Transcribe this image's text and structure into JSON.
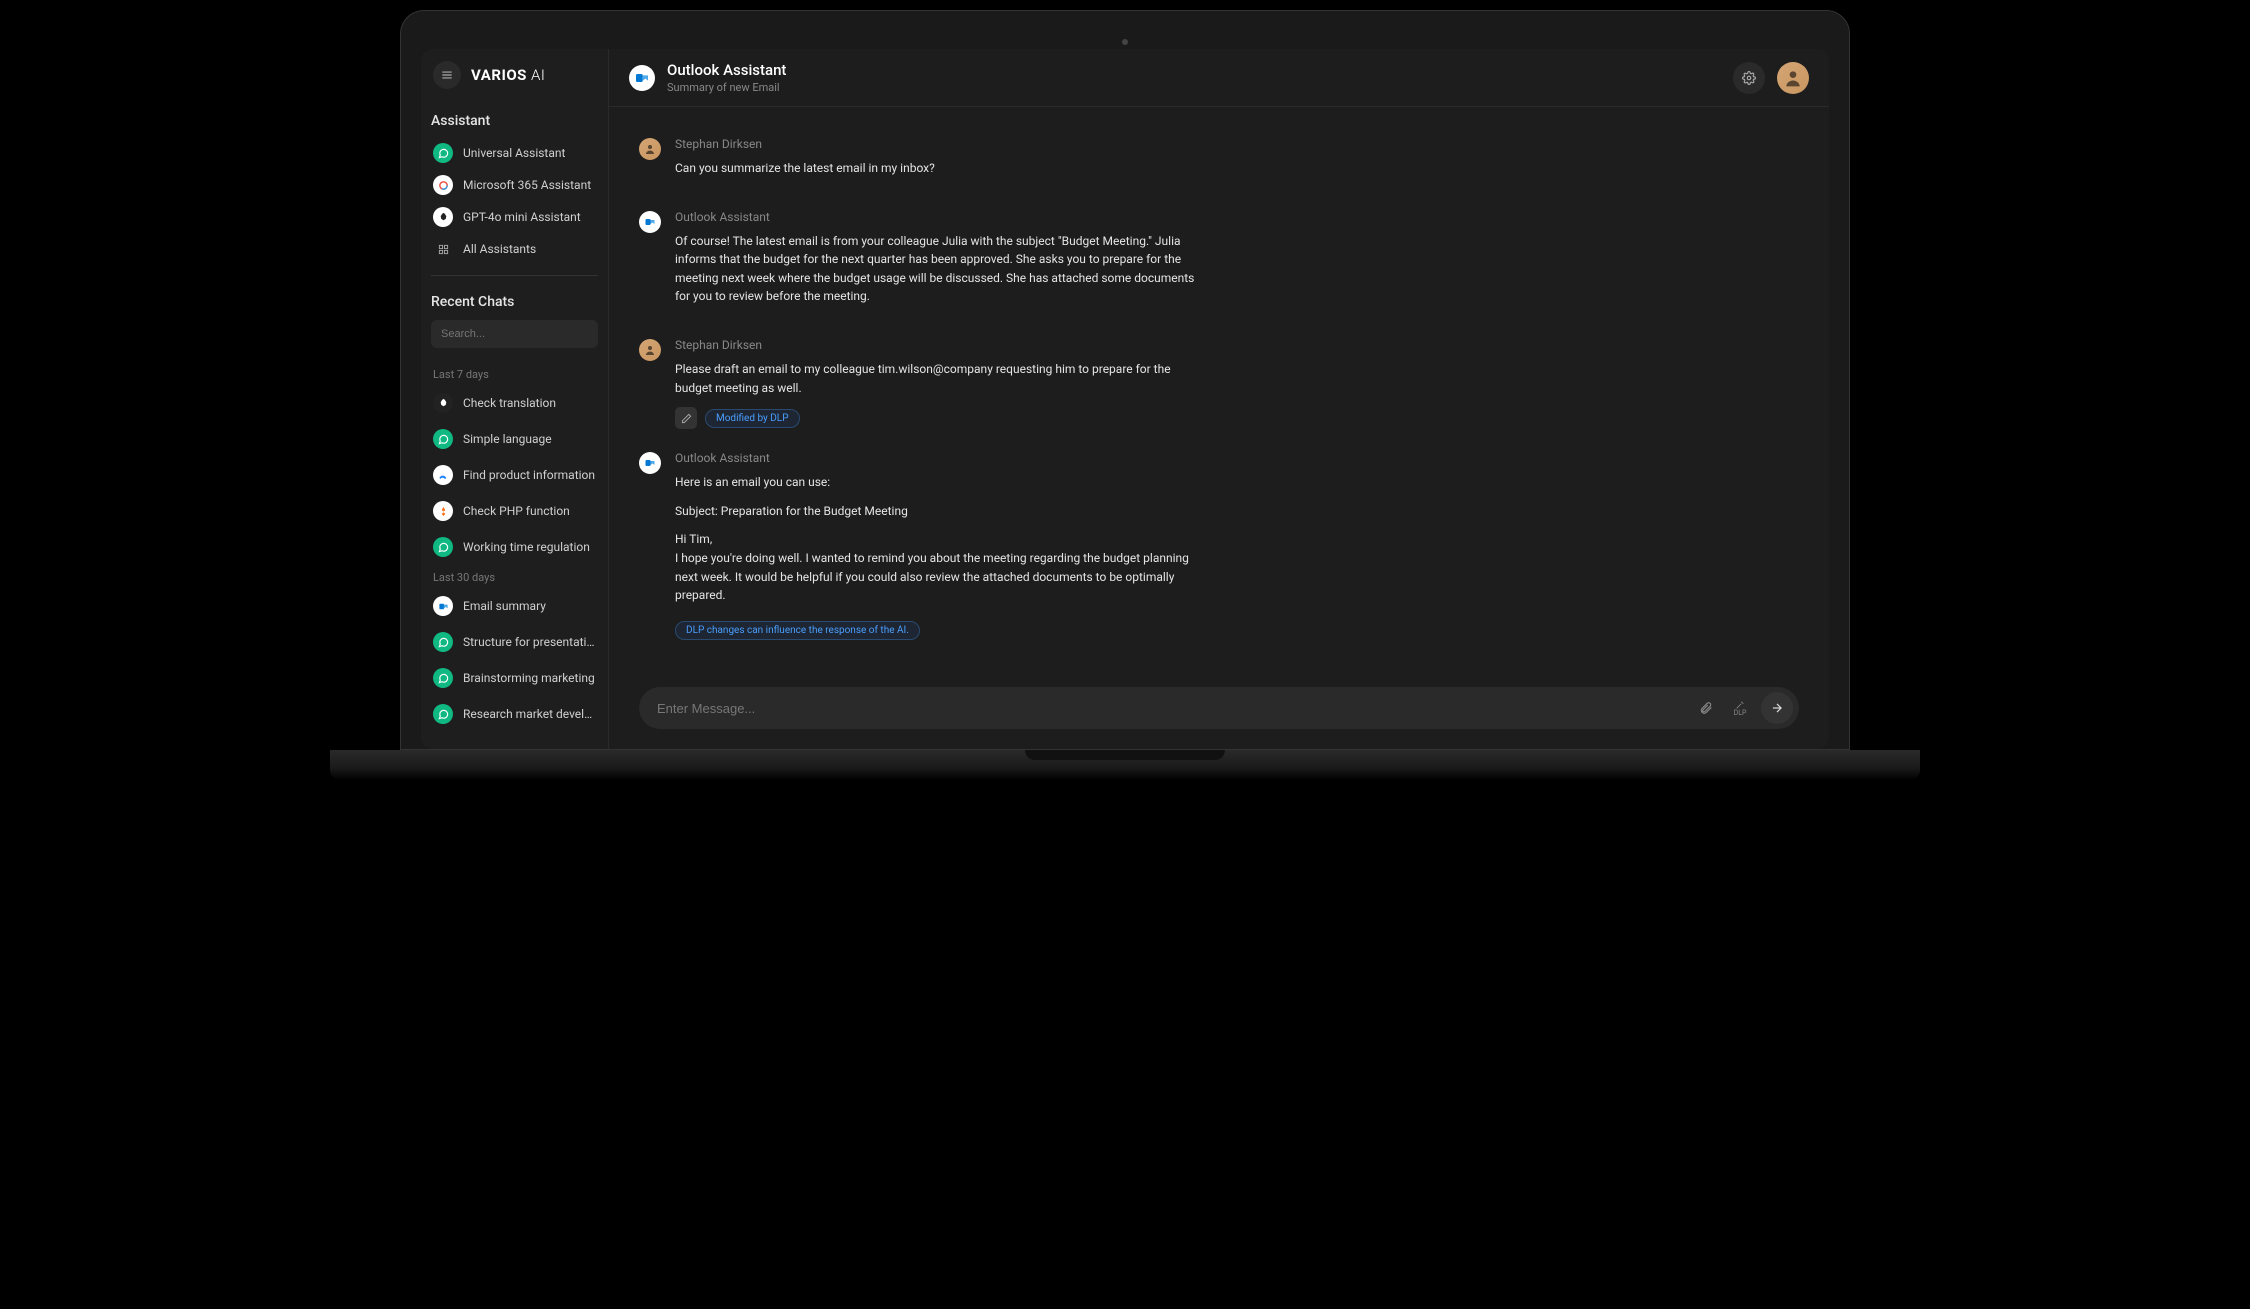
{
  "brand": {
    "bold": "VARIOS",
    "thin": " AI"
  },
  "sidebar": {
    "heading_assistant": "Assistant",
    "heading_recent": "Recent Chats",
    "search_placeholder": "Search...",
    "assistants": [
      {
        "label": "Universal Assistant",
        "icon": "chat-icon"
      },
      {
        "label": "Microsoft 365 Assistant",
        "icon": "m365-icon"
      },
      {
        "label": "GPT-4o mini Assistant",
        "icon": "openai-icon"
      },
      {
        "label": "All Assistants",
        "icon": "grid-icon"
      }
    ],
    "group1_label": "Last 7 days",
    "group1": [
      {
        "label": "Check translation",
        "icon": "openai-dark-icon"
      },
      {
        "label": "Simple language",
        "icon": "chat-icon"
      },
      {
        "label": "Find product information",
        "icon": "confluence-icon"
      },
      {
        "label": "Check PHP function",
        "icon": "php-icon"
      },
      {
        "label": "Working time regulation",
        "icon": "chat-icon"
      }
    ],
    "group2_label": "Last 30 days",
    "group2": [
      {
        "label": "Email summary",
        "icon": "outlook-icon"
      },
      {
        "label": "Structure for presentation",
        "icon": "chat-icon"
      },
      {
        "label": "Brainstorming marketing",
        "icon": "chat-icon"
      },
      {
        "label": "Research market develo...",
        "icon": "chat-icon"
      }
    ]
  },
  "header": {
    "title": "Outlook Assistant",
    "subtitle": "Summary of new Email"
  },
  "messages": [
    {
      "sender": "Stephan Dirksen",
      "role": "user",
      "body": [
        "Can you summarize the latest email in my inbox?"
      ]
    },
    {
      "sender": "Outlook Assistant",
      "role": "assistant",
      "body": [
        "Of course! The latest email is from your colleague Julia with the subject \"Budget Meeting.\" Julia informs that the budget for the next quarter has been approved. She asks you to prepare for the meeting next week where the budget usage will be discussed. She has attached some documents for you to review before the meeting."
      ]
    },
    {
      "sender": "Stephan Dirksen",
      "role": "user",
      "body": [
        "Please draft an email to my colleague tim.wilson@company requesting him to prepare for the budget meeting as well."
      ],
      "dlp_badge": "Modified by DLP"
    },
    {
      "sender": "Outlook Assistant",
      "role": "assistant",
      "body": [
        "Here is an email you can use:",
        "Subject: Preparation for the Budget Meeting",
        "Hi Tim,\nI hope you're doing well. I wanted to remind you about the meeting regarding the budget planning next week. It would be helpful if you could also review the attached documents to be optimally prepared."
      ],
      "dlp_note": "DLP changes can influence the response of the AI."
    }
  ],
  "composer": {
    "placeholder": "Enter Message...",
    "dlp_label": "DLP"
  }
}
